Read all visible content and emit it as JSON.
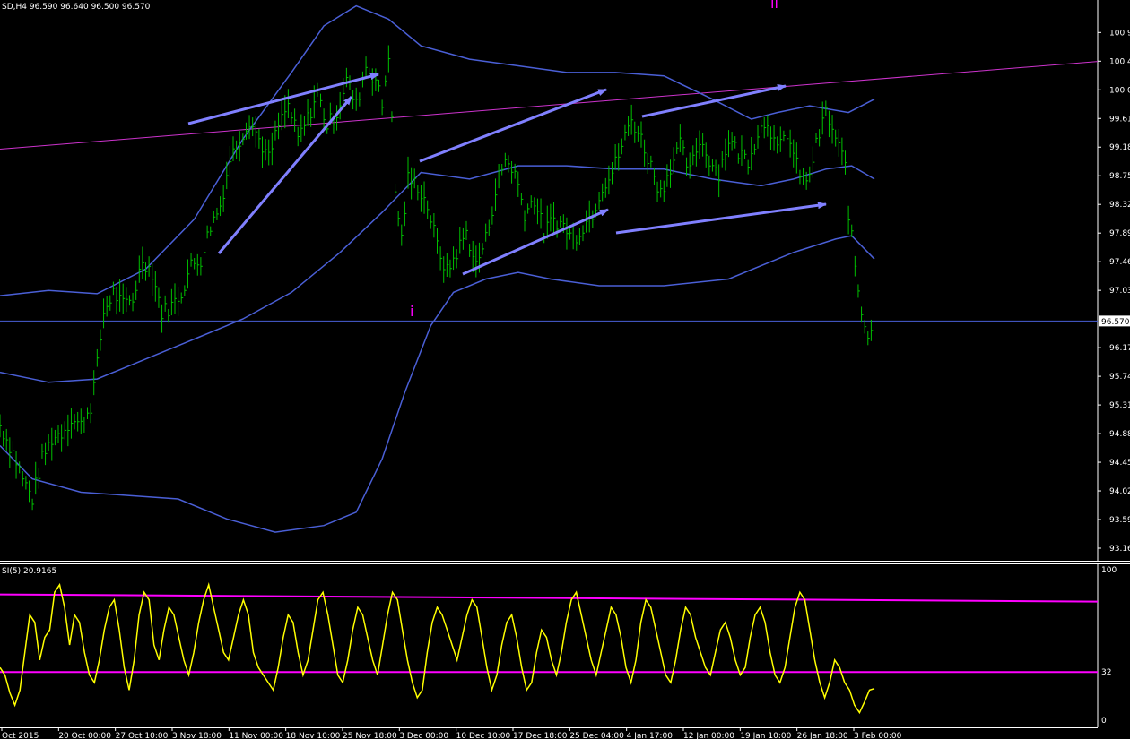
{
  "header": {
    "title": "SD,H4  96.590 96.640 96.500 96.570"
  },
  "indicator": {
    "title": "SI(5) 20.9165",
    "levels": [
      "100",
      "32",
      "0"
    ]
  },
  "wave_labels": [
    "i",
    "ii"
  ],
  "current_price_label": "96.570",
  "colors": {
    "background": "#000000",
    "candles": "#00c000",
    "bands": "#4a5fd6",
    "arrows": "#8080ff",
    "trendline": "#cc33cc",
    "si_line": "#ffff00",
    "si_levels": "#ff00ff",
    "text": "#ffffff"
  },
  "chart_data": [
    {
      "type": "line",
      "title": "SD,H4  96.590 96.640 96.500 96.570",
      "x_tick_labels": [
        "Oct 2015",
        "20 Oct 00:00",
        "27 Oct 10:00",
        "3 Nov 18:00",
        "11 Nov 00:00",
        "18 Nov 10:00",
        "25 Nov 18:00",
        "3 Dec 00:00",
        "10 Dec 10:00",
        "17 Dec 18:00",
        "25 Dec 04:00",
        "4 Jan 17:00",
        "12 Jan 00:00",
        "19 Jan 10:00",
        "26 Jan 18:00",
        "3 Feb 00:00"
      ],
      "y_tick_labels": [
        "100.900",
        "100.470",
        "100.040",
        "99.610",
        "99.180",
        "98.750",
        "98.320",
        "97.890",
        "97.460",
        "97.030",
        "96.570",
        "96.170",
        "95.740",
        "95.310",
        "94.880",
        "94.450",
        "94.020",
        "93.590",
        "93.160"
      ],
      "ylim": [
        93.16,
        101.2
      ],
      "x_index_range": [
        0,
        190
      ],
      "current_price": 96.57,
      "series": [
        {
          "kind": "price",
          "points": [
            [
              0,
              95.0
            ],
            [
              4,
              94.6
            ],
            [
              7,
              94.2
            ],
            [
              10,
              93.9
            ],
            [
              13,
              94.5
            ],
            [
              16,
              94.8
            ],
            [
              19,
              94.9
            ],
            [
              22,
              95.1
            ],
            [
              25,
              95.0
            ],
            [
              28,
              95.3
            ],
            [
              30,
              95.9
            ],
            [
              32,
              96.7
            ],
            [
              35,
              97.0
            ],
            [
              38,
              96.8
            ],
            [
              41,
              96.9
            ],
            [
              44,
              97.5
            ],
            [
              47,
              97.3
            ],
            [
              50,
              96.7
            ],
            [
              53,
              96.8
            ],
            [
              56,
              97.0
            ],
            [
              59,
              97.4
            ],
            [
              62,
              97.5
            ],
            [
              65,
              98.0
            ],
            [
              68,
              98.3
            ],
            [
              71,
              99.0
            ],
            [
              74,
              99.3
            ],
            [
              77,
              99.6
            ],
            [
              80,
              99.3
            ],
            [
              83,
              99.0
            ],
            [
              86,
              99.5
            ],
            [
              89,
              99.8
            ],
            [
              92,
              99.3
            ],
            [
              95,
              99.6
            ],
            [
              98,
              100.0
            ],
            [
              101,
              99.5
            ],
            [
              104,
              99.7
            ],
            [
              107,
              100.2
            ],
            [
              110,
              99.8
            ],
            [
              113,
              100.4
            ],
            [
              116,
              100.2
            ],
            [
              118,
              99.8
            ],
            [
              120,
              100.6
            ],
            [
              122,
              98.5
            ],
            [
              124,
              97.8
            ],
            [
              126,
              98.7
            ],
            [
              129,
              98.6
            ],
            [
              132,
              98.3
            ],
            [
              135,
              97.7
            ],
            [
              138,
              97.3
            ],
            [
              141,
              97.6
            ],
            [
              144,
              97.9
            ],
            [
              147,
              97.4
            ],
            [
              150,
              97.8
            ],
            [
              153,
              98.5
            ],
            [
              156,
              99.0
            ],
            [
              159,
              98.8
            ],
            [
              162,
              98.2
            ],
            [
              165,
              98.4
            ],
            [
              168,
              97.9
            ],
            [
              171,
              98.1
            ],
            [
              174,
              98.0
            ],
            [
              177,
              97.8
            ],
            [
              180,
              98.0
            ],
            [
              183,
              98.2
            ],
            [
              186,
              98.6
            ],
            [
              189,
              98.8
            ],
            [
              192,
              99.2
            ],
            [
              195,
              99.6
            ],
            [
              198,
              99.3
            ],
            [
              201,
              98.9
            ],
            [
              204,
              98.5
            ],
            [
              207,
              98.9
            ],
            [
              210,
              99.2
            ],
            [
              213,
              98.8
            ],
            [
              216,
              99.3
            ],
            [
              219,
              99.0
            ],
            [
              222,
              98.8
            ],
            [
              225,
              99.3
            ],
            [
              228,
              99.1
            ],
            [
              231,
              99.0
            ],
            [
              234,
              99.4
            ],
            [
              237,
              99.6
            ],
            [
              240,
              99.1
            ],
            [
              243,
              99.4
            ],
            [
              246,
              98.9
            ],
            [
              249,
              98.6
            ],
            [
              252,
              99.2
            ],
            [
              255,
              99.7
            ],
            [
              258,
              99.3
            ],
            [
              261,
              98.9
            ],
            [
              262,
              98.2
            ],
            [
              264,
              97.4
            ],
            [
              266,
              96.7
            ],
            [
              268,
              96.4
            ],
            [
              270,
              96.57
            ]
          ]
        },
        {
          "kind": "band-upper",
          "points": [
            [
              0,
              96.95
            ],
            [
              15,
              97.03
            ],
            [
              30,
              96.98
            ],
            [
              45,
              97.35
            ],
            [
              60,
              98.1
            ],
            [
              75,
              99.3
            ],
            [
              90,
              100.3
            ],
            [
              100,
              101.0
            ],
            [
              110,
              101.3
            ],
            [
              120,
              101.1
            ],
            [
              130,
              100.7
            ],
            [
              145,
              100.5
            ],
            [
              160,
              100.4
            ],
            [
              175,
              100.3
            ],
            [
              190,
              100.3
            ],
            [
              205,
              100.25
            ],
            [
              220,
              99.9
            ],
            [
              232,
              99.6
            ],
            [
              240,
              99.7
            ],
            [
              250,
              99.8
            ],
            [
              262,
              99.7
            ],
            [
              270,
              99.9
            ]
          ]
        },
        {
          "kind": "band-middle",
          "points": [
            [
              0,
              95.8
            ],
            [
              15,
              95.65
            ],
            [
              30,
              95.7
            ],
            [
              45,
              96.0
            ],
            [
              60,
              96.3
            ],
            [
              75,
              96.6
            ],
            [
              90,
              97.0
            ],
            [
              105,
              97.6
            ],
            [
              118,
              98.2
            ],
            [
              130,
              98.8
            ],
            [
              145,
              98.7
            ],
            [
              160,
              98.9
            ],
            [
              175,
              98.9
            ],
            [
              190,
              98.85
            ],
            [
              205,
              98.85
            ],
            [
              220,
              98.7
            ],
            [
              235,
              98.6
            ],
            [
              245,
              98.7
            ],
            [
              255,
              98.85
            ],
            [
              263,
              98.9
            ],
            [
              270,
              98.7
            ]
          ]
        },
        {
          "kind": "band-lower",
          "points": [
            [
              0,
              94.7
            ],
            [
              10,
              94.2
            ],
            [
              25,
              94.0
            ],
            [
              40,
              93.95
            ],
            [
              55,
              93.9
            ],
            [
              70,
              93.6
            ],
            [
              85,
              93.4
            ],
            [
              100,
              93.5
            ],
            [
              110,
              93.7
            ],
            [
              118,
              94.5
            ],
            [
              125,
              95.5
            ],
            [
              133,
              96.5
            ],
            [
              140,
              97.0
            ],
            [
              150,
              97.2
            ],
            [
              160,
              97.3
            ],
            [
              170,
              97.2
            ],
            [
              185,
              97.1
            ],
            [
              205,
              97.1
            ],
            [
              225,
              97.2
            ],
            [
              245,
              97.6
            ],
            [
              258,
              97.8
            ],
            [
              263,
              97.85
            ],
            [
              270,
              97.5
            ]
          ]
        },
        {
          "kind": "trendline",
          "points": [
            [
              0,
              99.15
            ],
            [
              335,
              100.45
            ]
          ]
        }
      ]
    },
    {
      "type": "line",
      "title": "SI(5) 20.9165",
      "ylim": [
        0,
        100
      ],
      "levels": [
        32,
        80
      ],
      "series": [
        {
          "kind": "oscillator",
          "values": [
            35,
            30,
            18,
            10,
            20,
            45,
            70,
            65,
            40,
            55,
            60,
            85,
            90,
            75,
            50,
            70,
            65,
            45,
            30,
            25,
            40,
            60,
            75,
            80,
            60,
            35,
            20,
            40,
            70,
            85,
            80,
            50,
            40,
            60,
            75,
            70,
            55,
            40,
            30,
            45,
            65,
            80,
            90,
            75,
            60,
            45,
            40,
            55,
            70,
            80,
            70,
            45,
            35,
            30,
            25,
            20,
            35,
            55,
            70,
            65,
            45,
            30,
            40,
            60,
            80,
            85,
            70,
            50,
            30,
            25,
            40,
            60,
            75,
            70,
            55,
            40,
            30,
            50,
            70,
            85,
            80,
            60,
            40,
            25,
            15,
            20,
            45,
            65,
            75,
            70,
            60,
            50,
            40,
            55,
            70,
            80,
            75,
            55,
            35,
            20,
            30,
            50,
            65,
            70,
            55,
            35,
            20,
            25,
            45,
            60,
            55,
            40,
            30,
            45,
            65,
            80,
            85,
            70,
            55,
            40,
            30,
            45,
            60,
            75,
            70,
            55,
            35,
            25,
            40,
            65,
            80,
            75,
            60,
            45,
            30,
            25,
            40,
            60,
            75,
            70,
            55,
            45,
            35,
            30,
            45,
            60,
            65,
            55,
            40,
            30,
            35,
            55,
            70,
            75,
            65,
            45,
            30,
            25,
            35,
            55,
            75,
            85,
            80,
            60,
            40,
            25,
            15,
            25,
            40,
            35,
            25,
            20,
            10,
            5,
            12,
            20,
            21
          ]
        }
      ]
    }
  ]
}
